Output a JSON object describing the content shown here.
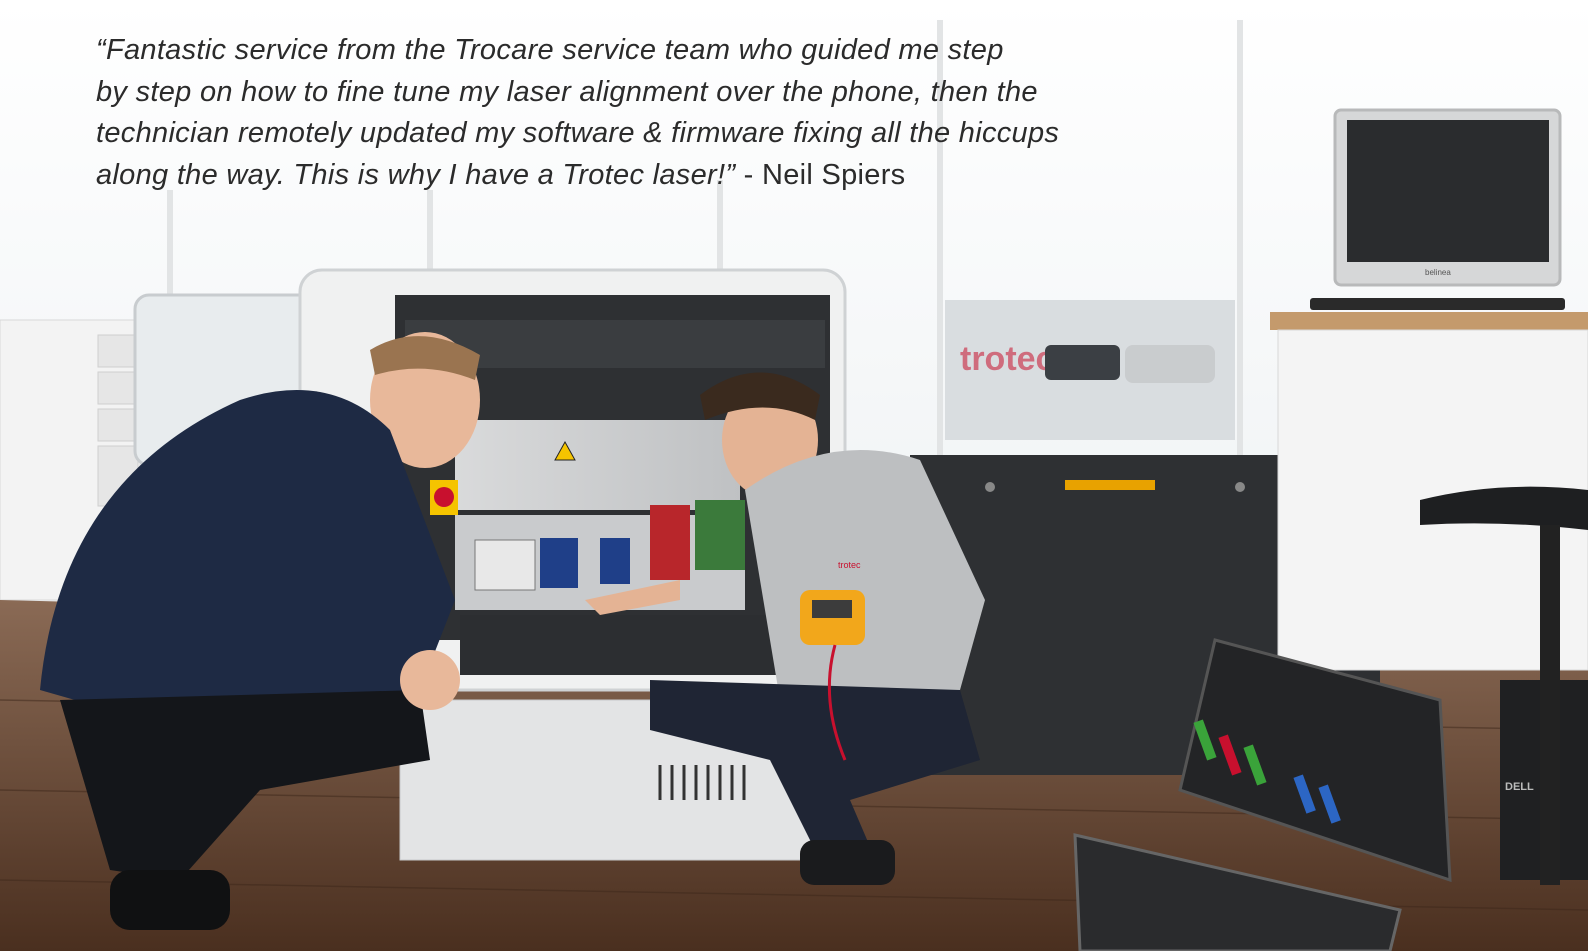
{
  "testimonial": {
    "quote_lines": [
      "“Fantastic service from the Trocare service team who guided me step",
      "by step on how to fine tune my laser alignment over the phone, then the",
      "technician remotely updated my software & firmware fixing all the hiccups",
      "along the way. This is why I have a Trotec laser!”"
    ],
    "attribution": " - Neil Spiers"
  },
  "scene_text": {
    "window_sign": "trotec",
    "polo_logo": "trotec",
    "monitor_brand": "belinea",
    "pc_brand": "DELL"
  },
  "colors": {
    "floor": "#5a3d2a",
    "machine_body": "#2e3033",
    "accent_red": "#c8102e",
    "multimeter_yellow": "#f2a71b",
    "quote_text": "#2b2b2b"
  }
}
